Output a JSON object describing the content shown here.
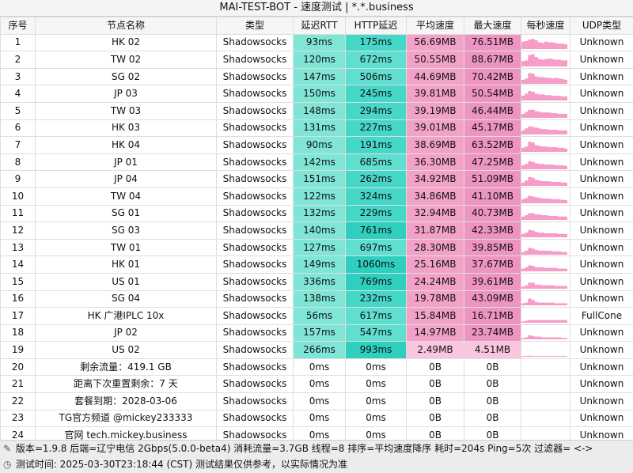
{
  "title": "MAI-TEST-BOT - 速度测试 | *.*.business",
  "headers": [
    "序号",
    "节点名称",
    "类型",
    "延迟RTT",
    "HTTP延迟",
    "平均速度",
    "最大速度",
    "每秒速度",
    "UDP类型"
  ],
  "rows": [
    {
      "idx": "1",
      "name": "HK 02",
      "type": "Shadowsocks",
      "rtt": "93ms",
      "http": "175ms",
      "avg": "56.69MB",
      "max": "76.51MB",
      "udp": "Unknown",
      "spark": [
        0.55,
        0.6,
        0.7,
        0.75,
        0.65,
        0.5,
        0.45,
        0.55,
        0.5,
        0.5,
        0.45,
        0.4,
        0.4,
        0.35
      ]
    },
    {
      "idx": "2",
      "name": "TW 02",
      "type": "Shadowsocks",
      "rtt": "120ms",
      "http": "672ms",
      "avg": "50.55MB",
      "max": "88.67MB",
      "udp": "Unknown",
      "spark": [
        0.4,
        0.45,
        0.85,
        0.9,
        0.7,
        0.55,
        0.5,
        0.55,
        0.6,
        0.55,
        0.5,
        0.5,
        0.45,
        0.45
      ]
    },
    {
      "idx": "3",
      "name": "SG 02",
      "type": "Shadowsocks",
      "rtt": "147ms",
      "http": "506ms",
      "avg": "44.69MB",
      "max": "70.42MB",
      "udp": "Unknown",
      "spark": [
        0.3,
        0.4,
        0.8,
        0.75,
        0.55,
        0.5,
        0.5,
        0.45,
        0.45,
        0.4,
        0.45,
        0.4,
        0.35,
        0.3
      ]
    },
    {
      "idx": "4",
      "name": "JP 03",
      "type": "Shadowsocks",
      "rtt": "150ms",
      "http": "245ms",
      "avg": "39.81MB",
      "max": "50.54MB",
      "udp": "Unknown",
      "spark": [
        0.35,
        0.5,
        0.7,
        0.65,
        0.5,
        0.45,
        0.45,
        0.4,
        0.4,
        0.35,
        0.35,
        0.35,
        0.3,
        0.3
      ]
    },
    {
      "idx": "5",
      "name": "TW 03",
      "type": "Shadowsocks",
      "rtt": "148ms",
      "http": "294ms",
      "avg": "39.19MB",
      "max": "46.44MB",
      "udp": "Unknown",
      "spark": [
        0.3,
        0.45,
        0.6,
        0.6,
        0.5,
        0.45,
        0.4,
        0.4,
        0.4,
        0.35,
        0.35,
        0.3,
        0.3,
        0.3
      ]
    },
    {
      "idx": "6",
      "name": "HK 03",
      "type": "Shadowsocks",
      "rtt": "131ms",
      "http": "227ms",
      "avg": "39.01MB",
      "max": "45.17MB",
      "udp": "Unknown",
      "spark": [
        0.3,
        0.45,
        0.6,
        0.55,
        0.5,
        0.45,
        0.4,
        0.4,
        0.35,
        0.35,
        0.35,
        0.3,
        0.3,
        0.3
      ]
    },
    {
      "idx": "7",
      "name": "HK 04",
      "type": "Shadowsocks",
      "rtt": "90ms",
      "http": "191ms",
      "avg": "38.69MB",
      "max": "63.52MB",
      "udp": "Unknown",
      "spark": [
        0.3,
        0.4,
        0.75,
        0.7,
        0.5,
        0.45,
        0.4,
        0.4,
        0.35,
        0.35,
        0.35,
        0.3,
        0.3,
        0.25
      ]
    },
    {
      "idx": "8",
      "name": "JP 01",
      "type": "Shadowsocks",
      "rtt": "142ms",
      "http": "685ms",
      "avg": "36.30MB",
      "max": "47.25MB",
      "udp": "Unknown",
      "spark": [
        0.3,
        0.4,
        0.6,
        0.55,
        0.45,
        0.4,
        0.4,
        0.35,
        0.35,
        0.35,
        0.3,
        0.3,
        0.3,
        0.25
      ]
    },
    {
      "idx": "9",
      "name": "JP 04",
      "type": "Shadowsocks",
      "rtt": "151ms",
      "http": "262ms",
      "avg": "34.92MB",
      "max": "51.09MB",
      "udp": "Unknown",
      "spark": [
        0.25,
        0.4,
        0.65,
        0.6,
        0.45,
        0.4,
        0.35,
        0.35,
        0.35,
        0.3,
        0.3,
        0.3,
        0.25,
        0.25
      ]
    },
    {
      "idx": "10",
      "name": "TW 04",
      "type": "Shadowsocks",
      "rtt": "122ms",
      "http": "324ms",
      "avg": "34.86MB",
      "max": "41.10MB",
      "udp": "Unknown",
      "spark": [
        0.3,
        0.4,
        0.55,
        0.5,
        0.45,
        0.4,
        0.35,
        0.35,
        0.35,
        0.3,
        0.3,
        0.3,
        0.25,
        0.25
      ]
    },
    {
      "idx": "11",
      "name": "SG 01",
      "type": "Shadowsocks",
      "rtt": "132ms",
      "http": "229ms",
      "avg": "32.94MB",
      "max": "40.73MB",
      "udp": "Unknown",
      "spark": [
        0.25,
        0.35,
        0.5,
        0.5,
        0.4,
        0.4,
        0.35,
        0.35,
        0.3,
        0.3,
        0.3,
        0.25,
        0.25,
        0.25
      ]
    },
    {
      "idx": "12",
      "name": "SG 03",
      "type": "Shadowsocks",
      "rtt": "140ms",
      "http": "761ms",
      "avg": "31.87MB",
      "max": "42.33MB",
      "udp": "Unknown",
      "spark": [
        0.25,
        0.35,
        0.55,
        0.5,
        0.4,
        0.35,
        0.35,
        0.3,
        0.3,
        0.3,
        0.3,
        0.25,
        0.25,
        0.25
      ]
    },
    {
      "idx": "13",
      "name": "TW 01",
      "type": "Shadowsocks",
      "rtt": "127ms",
      "http": "697ms",
      "avg": "28.30MB",
      "max": "39.85MB",
      "udp": "Unknown",
      "spark": [
        0.2,
        0.3,
        0.5,
        0.45,
        0.35,
        0.3,
        0.3,
        0.3,
        0.3,
        0.25,
        0.25,
        0.25,
        0.2,
        0.2
      ]
    },
    {
      "idx": "14",
      "name": "HK 01",
      "type": "Shadowsocks",
      "rtt": "149ms",
      "http": "1060ms",
      "avg": "25.16MB",
      "max": "37.67MB",
      "udp": "Unknown",
      "spark": [
        0.2,
        0.3,
        0.45,
        0.4,
        0.3,
        0.3,
        0.3,
        0.25,
        0.25,
        0.25,
        0.25,
        0.2,
        0.2,
        0.2
      ]
    },
    {
      "idx": "15",
      "name": "US 01",
      "type": "Shadowsocks",
      "rtt": "336ms",
      "http": "769ms",
      "avg": "24.24MB",
      "max": "39.61MB",
      "udp": "Unknown",
      "spark": [
        0.15,
        0.25,
        0.45,
        0.45,
        0.3,
        0.3,
        0.25,
        0.25,
        0.25,
        0.25,
        0.2,
        0.2,
        0.2,
        0.2
      ]
    },
    {
      "idx": "16",
      "name": "SG 04",
      "type": "Shadowsocks",
      "rtt": "138ms",
      "http": "232ms",
      "avg": "19.78MB",
      "max": "43.09MB",
      "udp": "Unknown",
      "spark": [
        0.15,
        0.2,
        0.5,
        0.4,
        0.25,
        0.2,
        0.2,
        0.2,
        0.2,
        0.2,
        0.15,
        0.15,
        0.15,
        0.15
      ]
    },
    {
      "idx": "17",
      "name": "HK 广港IPLC 10x",
      "type": "Shadowsocks",
      "rtt": "56ms",
      "http": "617ms",
      "avg": "15.84MB",
      "max": "16.71MB",
      "udp": "FullCone",
      "spark": [
        0.1,
        0.15,
        0.2,
        0.2,
        0.2,
        0.2,
        0.2,
        0.2,
        0.2,
        0.2,
        0.2,
        0.2,
        0.2,
        0.2
      ]
    },
    {
      "idx": "18",
      "name": "JP 02",
      "type": "Shadowsocks",
      "rtt": "157ms",
      "http": "547ms",
      "avg": "14.97MB",
      "max": "23.74MB",
      "udp": "Unknown",
      "spark": [
        0.1,
        0.15,
        0.3,
        0.25,
        0.2,
        0.2,
        0.15,
        0.15,
        0.15,
        0.15,
        0.15,
        0.15,
        0.1,
        0.1
      ]
    },
    {
      "idx": "19",
      "name": "US 02",
      "type": "Shadowsocks",
      "rtt": "266ms",
      "http": "993ms",
      "avg": "2.49MB",
      "max": "4.51MB",
      "udp": "Unknown",
      "spark": [
        0.05,
        0.05,
        0.08,
        0.06,
        0.05,
        0.05,
        0.05,
        0.04,
        0.04,
        0.04,
        0.04,
        0.04,
        0.03,
        0.03
      ]
    },
    {
      "idx": "20",
      "name": "剩余流量：419.1 GB",
      "type": "Shadowsocks",
      "rtt": "0ms",
      "http": "0ms",
      "avg": "0B",
      "max": "0B",
      "udp": "Unknown",
      "spark": []
    },
    {
      "idx": "21",
      "name": "距离下次重置剩余：7 天",
      "type": "Shadowsocks",
      "rtt": "0ms",
      "http": "0ms",
      "avg": "0B",
      "max": "0B",
      "udp": "Unknown",
      "spark": []
    },
    {
      "idx": "22",
      "name": "套餐到期：2028-03-06",
      "type": "Shadowsocks",
      "rtt": "0ms",
      "http": "0ms",
      "avg": "0B",
      "max": "0B",
      "udp": "Unknown",
      "spark": []
    },
    {
      "idx": "23",
      "name": "TG官方频道 @mickey233333",
      "type": "Shadowsocks",
      "rtt": "0ms",
      "http": "0ms",
      "avg": "0B",
      "max": "0B",
      "udp": "Unknown",
      "spark": []
    },
    {
      "idx": "24",
      "name": "官网 tech.mickey.business",
      "type": "Shadowsocks",
      "rtt": "0ms",
      "http": "0ms",
      "avg": "0B",
      "max": "0B",
      "udp": "Unknown",
      "spark": []
    }
  ],
  "footer": {
    "line1": "版本=1.9.8  后端=辽宁电信 2Gbps(5.0.0-beta4) 消耗流量=3.7GB  线程=8  排序=平均速度降序  耗时=204s  Ping=5次  过滤器= <->",
    "line2": "测试时间: 2025-03-30T23:18:44 (CST)  测试结果仅供参考，以实际情况为准",
    "icon1": "pen-icon",
    "icon2": "clock-icon"
  },
  "colors": {
    "rtt": "#7fe6d6",
    "http": "#45d8c8",
    "avg": "#f2a2c9",
    "max": "#ee94c2",
    "spark": "#f59cc8"
  }
}
